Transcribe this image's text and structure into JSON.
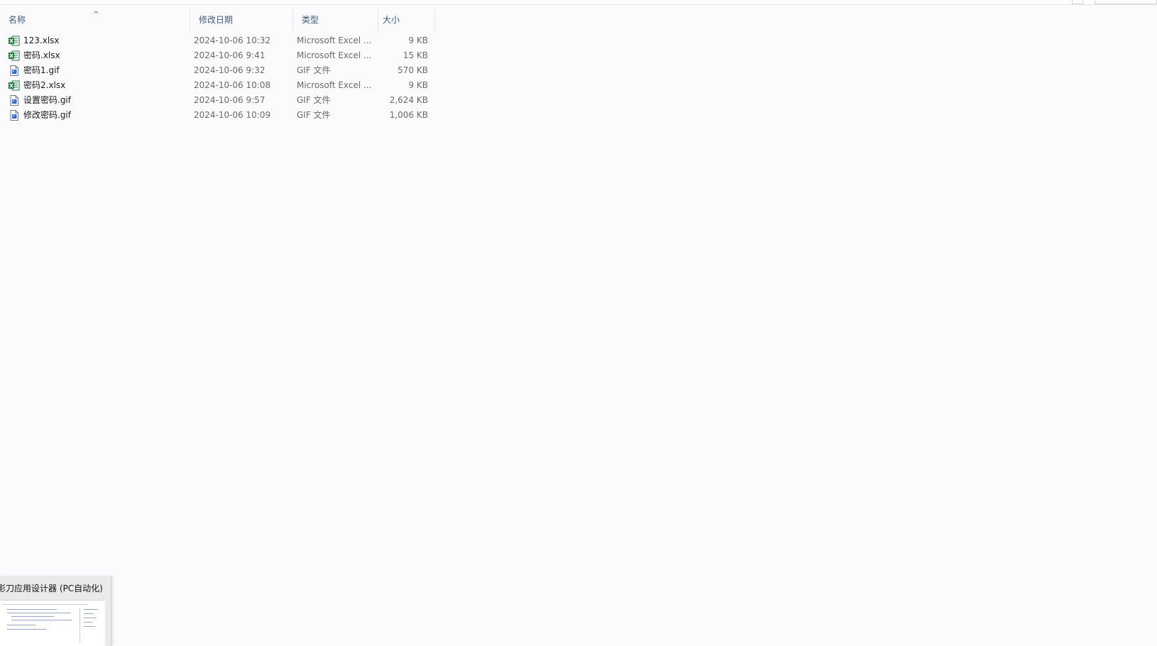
{
  "columns": {
    "name": "名称",
    "date": "修改日期",
    "type": "类型",
    "size": "大小"
  },
  "sort_indicator": "^",
  "files": [
    {
      "name": "123.xlsx",
      "date": "2024-10-06 10:32",
      "type": "Microsoft Excel ...",
      "size": "9 KB",
      "icon": "excel-file-icon"
    },
    {
      "name": "密码.xlsx",
      "date": "2024-10-06 9:41",
      "type": "Microsoft Excel ...",
      "size": "15 KB",
      "icon": "excel-file-icon"
    },
    {
      "name": "密码1.gif",
      "date": "2024-10-06 9:32",
      "type": "GIF 文件",
      "size": "570 KB",
      "icon": "gif-file-icon"
    },
    {
      "name": "密码2.xlsx",
      "date": "2024-10-06 10:08",
      "type": "Microsoft Excel ...",
      "size": "9 KB",
      "icon": "excel-file-icon"
    },
    {
      "name": "设置密码.gif",
      "date": "2024-10-06 9:57",
      "type": "GIF 文件",
      "size": "2,624 KB",
      "icon": "gif-file-icon"
    },
    {
      "name": "修改密码.gif",
      "date": "2024-10-06 10:09",
      "type": "GIF 文件",
      "size": "1,006 KB",
      "icon": "gif-file-icon"
    }
  ],
  "taskbar_preview": {
    "title": "影刀应用设计器 (PC自动化)"
  },
  "colors": {
    "header_text": "#3d5a80",
    "excel_green": "#1d7a3f",
    "gif_blue": "#2f6fc8"
  }
}
